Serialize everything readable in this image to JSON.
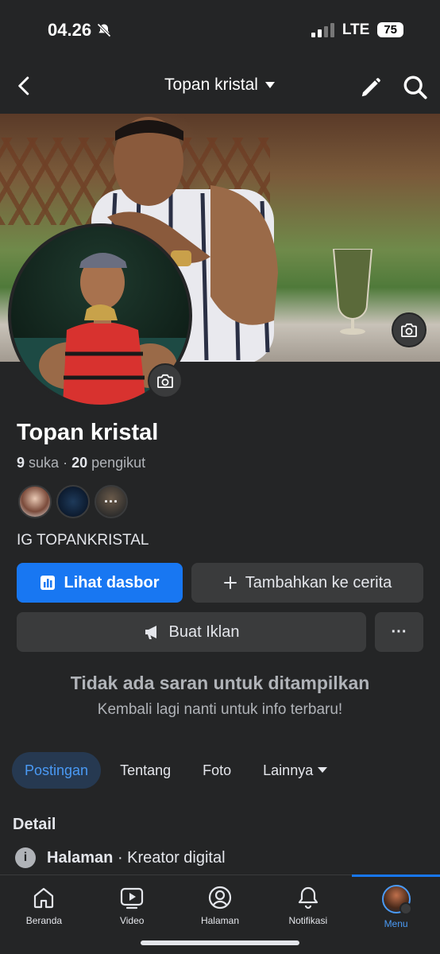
{
  "status": {
    "time": "04.26",
    "network": "LTE",
    "battery": "75"
  },
  "header": {
    "title": "Topan kristal"
  },
  "profile": {
    "name": "Topan kristal",
    "likes_count": "9",
    "likes_label": "suka",
    "followers_count": "20",
    "followers_label": "pengikut",
    "bio": "IG TOPANKRISTAL"
  },
  "actions": {
    "dashboard": "Lihat dasbor",
    "add_story": "Tambahkan ke cerita",
    "ads": "Buat Iklan",
    "more": "···"
  },
  "suggestions": {
    "title": "Tidak ada saran untuk ditampilkan",
    "subtitle": "Kembali lagi nanti untuk info terbaru!"
  },
  "tabs": [
    {
      "label": "Postingan"
    },
    {
      "label": "Tentang"
    },
    {
      "label": "Foto"
    },
    {
      "label": "Lainnya"
    }
  ],
  "details": {
    "title": "Detail",
    "row_bold": "Halaman",
    "row_rest": "· Kreator digital"
  },
  "nav": [
    {
      "label": "Beranda",
      "icon": "home-icon"
    },
    {
      "label": "Video",
      "icon": "video-icon"
    },
    {
      "label": "Halaman",
      "icon": "pages-icon"
    },
    {
      "label": "Notifikasi",
      "icon": "bell-icon"
    },
    {
      "label": "Menu",
      "icon": "menu-avatar"
    }
  ],
  "colors": {
    "accent": "#1877f2",
    "background": "#242526",
    "surface": "#3a3b3c",
    "tab_active": "#263951"
  }
}
